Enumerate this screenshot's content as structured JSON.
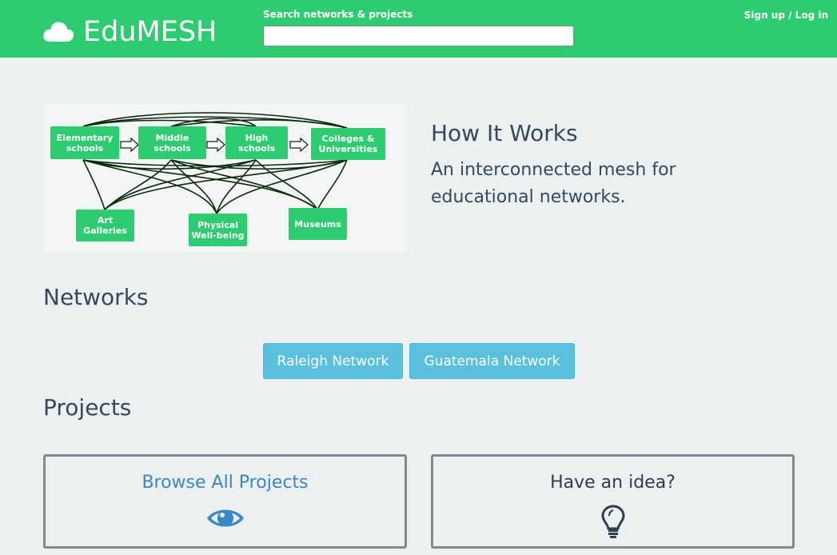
{
  "header": {
    "brand": "EduMESH",
    "search_label": "Search networks & projects",
    "search_placeholder": "",
    "signup_link": "Sign up / Log in"
  },
  "diagram": {
    "nodes": {
      "elementary": "Elementary schools",
      "middle": "Middle schools",
      "high": "High schools",
      "colleges": "Colleges & Universities",
      "art": "Art Galleries",
      "physical": "Physical Well-being",
      "museums": "Museums"
    }
  },
  "how_it_works": {
    "title": "How It Works",
    "description": "An interconnected mesh for educational networks."
  },
  "networks": {
    "title": "Networks",
    "buttons": [
      "Raleigh Network",
      "Guatemala Network"
    ]
  },
  "projects": {
    "title": "Projects",
    "cards": [
      {
        "title": "Browse All Projects",
        "icon": "eye-icon",
        "color": "#3a87c8"
      },
      {
        "title": "Have an idea?",
        "icon": "lightbulb-icon",
        "color": "#2c3e50"
      }
    ]
  },
  "colors": {
    "header_bg": "#2ecc71",
    "page_bg": "#ecf0f1",
    "network_button": "#5bc0de"
  }
}
